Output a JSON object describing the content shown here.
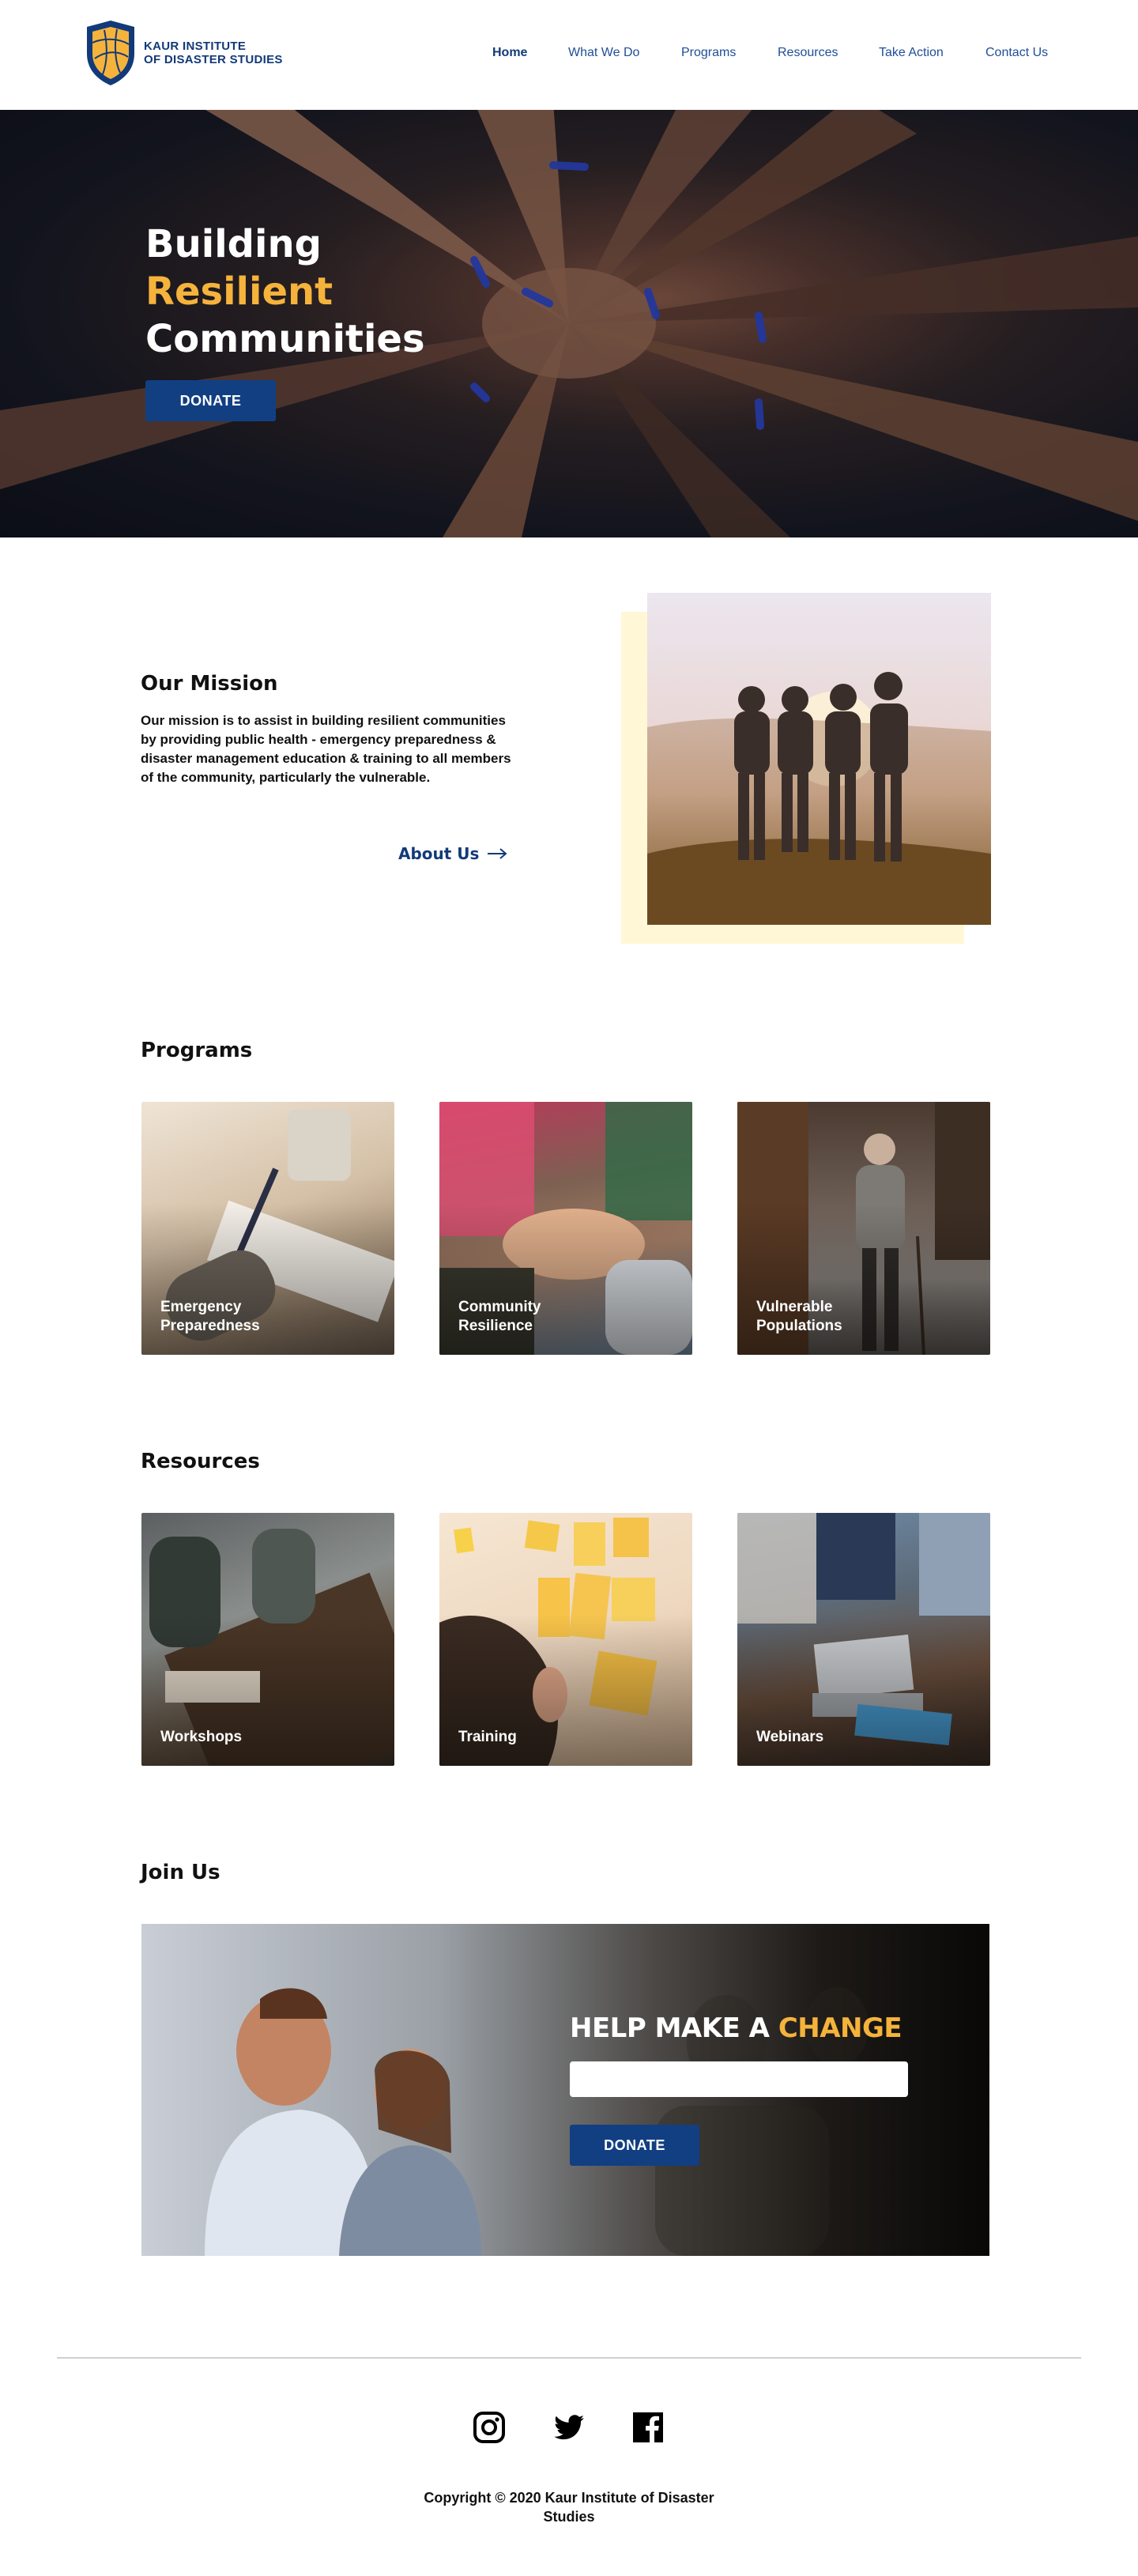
{
  "brand": {
    "line1": "KAUR INSTITUTE",
    "line2": "OF DISASTER STUDIES"
  },
  "nav": {
    "items": [
      {
        "label": "Home",
        "active": true
      },
      {
        "label": "What We Do"
      },
      {
        "label": "Programs"
      },
      {
        "label": "Resources"
      },
      {
        "label": "Take Action"
      },
      {
        "label": "Contact Us"
      }
    ]
  },
  "hero": {
    "line1": "Building",
    "line2": "Resilient",
    "line3": "Communities",
    "donate_label": "DONATE"
  },
  "mission": {
    "title": "Our Mission",
    "text": "Our mission is to assist in building resilient communities by providing public health - emergency preparedness & disaster management education & training to all members of the community, particularly the vulnerable.",
    "link_label": "About Us"
  },
  "programs": {
    "title": "Programs",
    "items": [
      {
        "label": "Emergency Preparedness"
      },
      {
        "label": "Community Resilience"
      },
      {
        "label": "Vulnerable Populations"
      }
    ]
  },
  "resources": {
    "title": "Resources",
    "items": [
      {
        "label": "Workshops"
      },
      {
        "label": "Training"
      },
      {
        "label": "Webinars"
      }
    ]
  },
  "join": {
    "title": "Join Us",
    "heading_main": "HELP MAKE A ",
    "heading_accent": "CHANGE",
    "input_value": "",
    "input_placeholder": "",
    "donate_label": "DONATE"
  },
  "footer": {
    "social": [
      "instagram-icon",
      "twitter-icon",
      "facebook-icon"
    ],
    "copyright": "Copyright © 2020 Kaur Institute of Disaster Studies"
  },
  "colors": {
    "brand_navy": "#123a78",
    "accent_gold": "#f5b33c",
    "button_blue": "#123f82"
  }
}
